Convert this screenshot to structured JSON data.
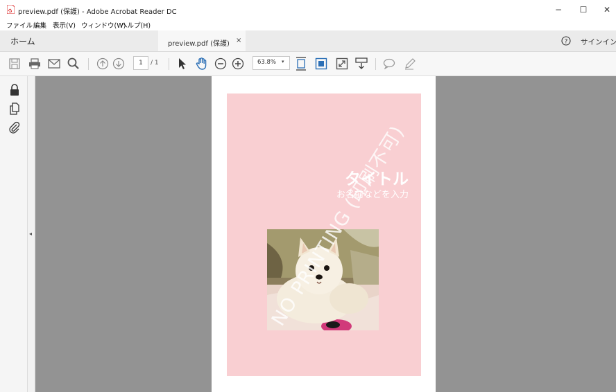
{
  "window": {
    "title": "preview.pdf (保護) - Adobe Acrobat Reader DC",
    "minimize_glyph": "−",
    "maximize_glyph": "☐",
    "close_glyph": "✕"
  },
  "menu": [
    "ファイル",
    "編集",
    "表示(V)",
    "ウィンドウ(W)",
    "ヘルプ(H)"
  ],
  "tabs": {
    "home": "ホーム",
    "document": "preview.pdf (保護)",
    "close_glyph": "×"
  },
  "header_right": {
    "help_icon": "question-circle-icon",
    "signin": "サインイン"
  },
  "toolbar": {
    "icons": [
      "save-icon",
      "print-icon",
      "email-icon",
      "search-icon",
      "previous-page-icon",
      "next-page-icon",
      "select-pointer-icon",
      "hand-tool-icon",
      "zoom-out-icon",
      "zoom-in-icon",
      "fit-page-icon",
      "fit-width-icon",
      "full-screen-icon",
      "scroll-mode-icon",
      "comment-icon",
      "sign-pen-icon"
    ],
    "page_current": "1",
    "page_total": "/ 1",
    "zoom": "63.8%",
    "zoom_arrow": "▾"
  },
  "left_panel": {
    "icons": [
      "lock-icon",
      "copy-pages-icon",
      "attachment-icon"
    ],
    "collapse_glyph": "◂"
  },
  "document": {
    "title": "タイトル",
    "subtitle": "お名前などを入力",
    "watermark": "NO PRINTING (印刷不可)",
    "page_background": "#f9cfd2"
  },
  "colors": {
    "viewer_bg": "#939393",
    "accent_blue": "#2b6fb6",
    "pdf_red": "#e23b2e"
  }
}
